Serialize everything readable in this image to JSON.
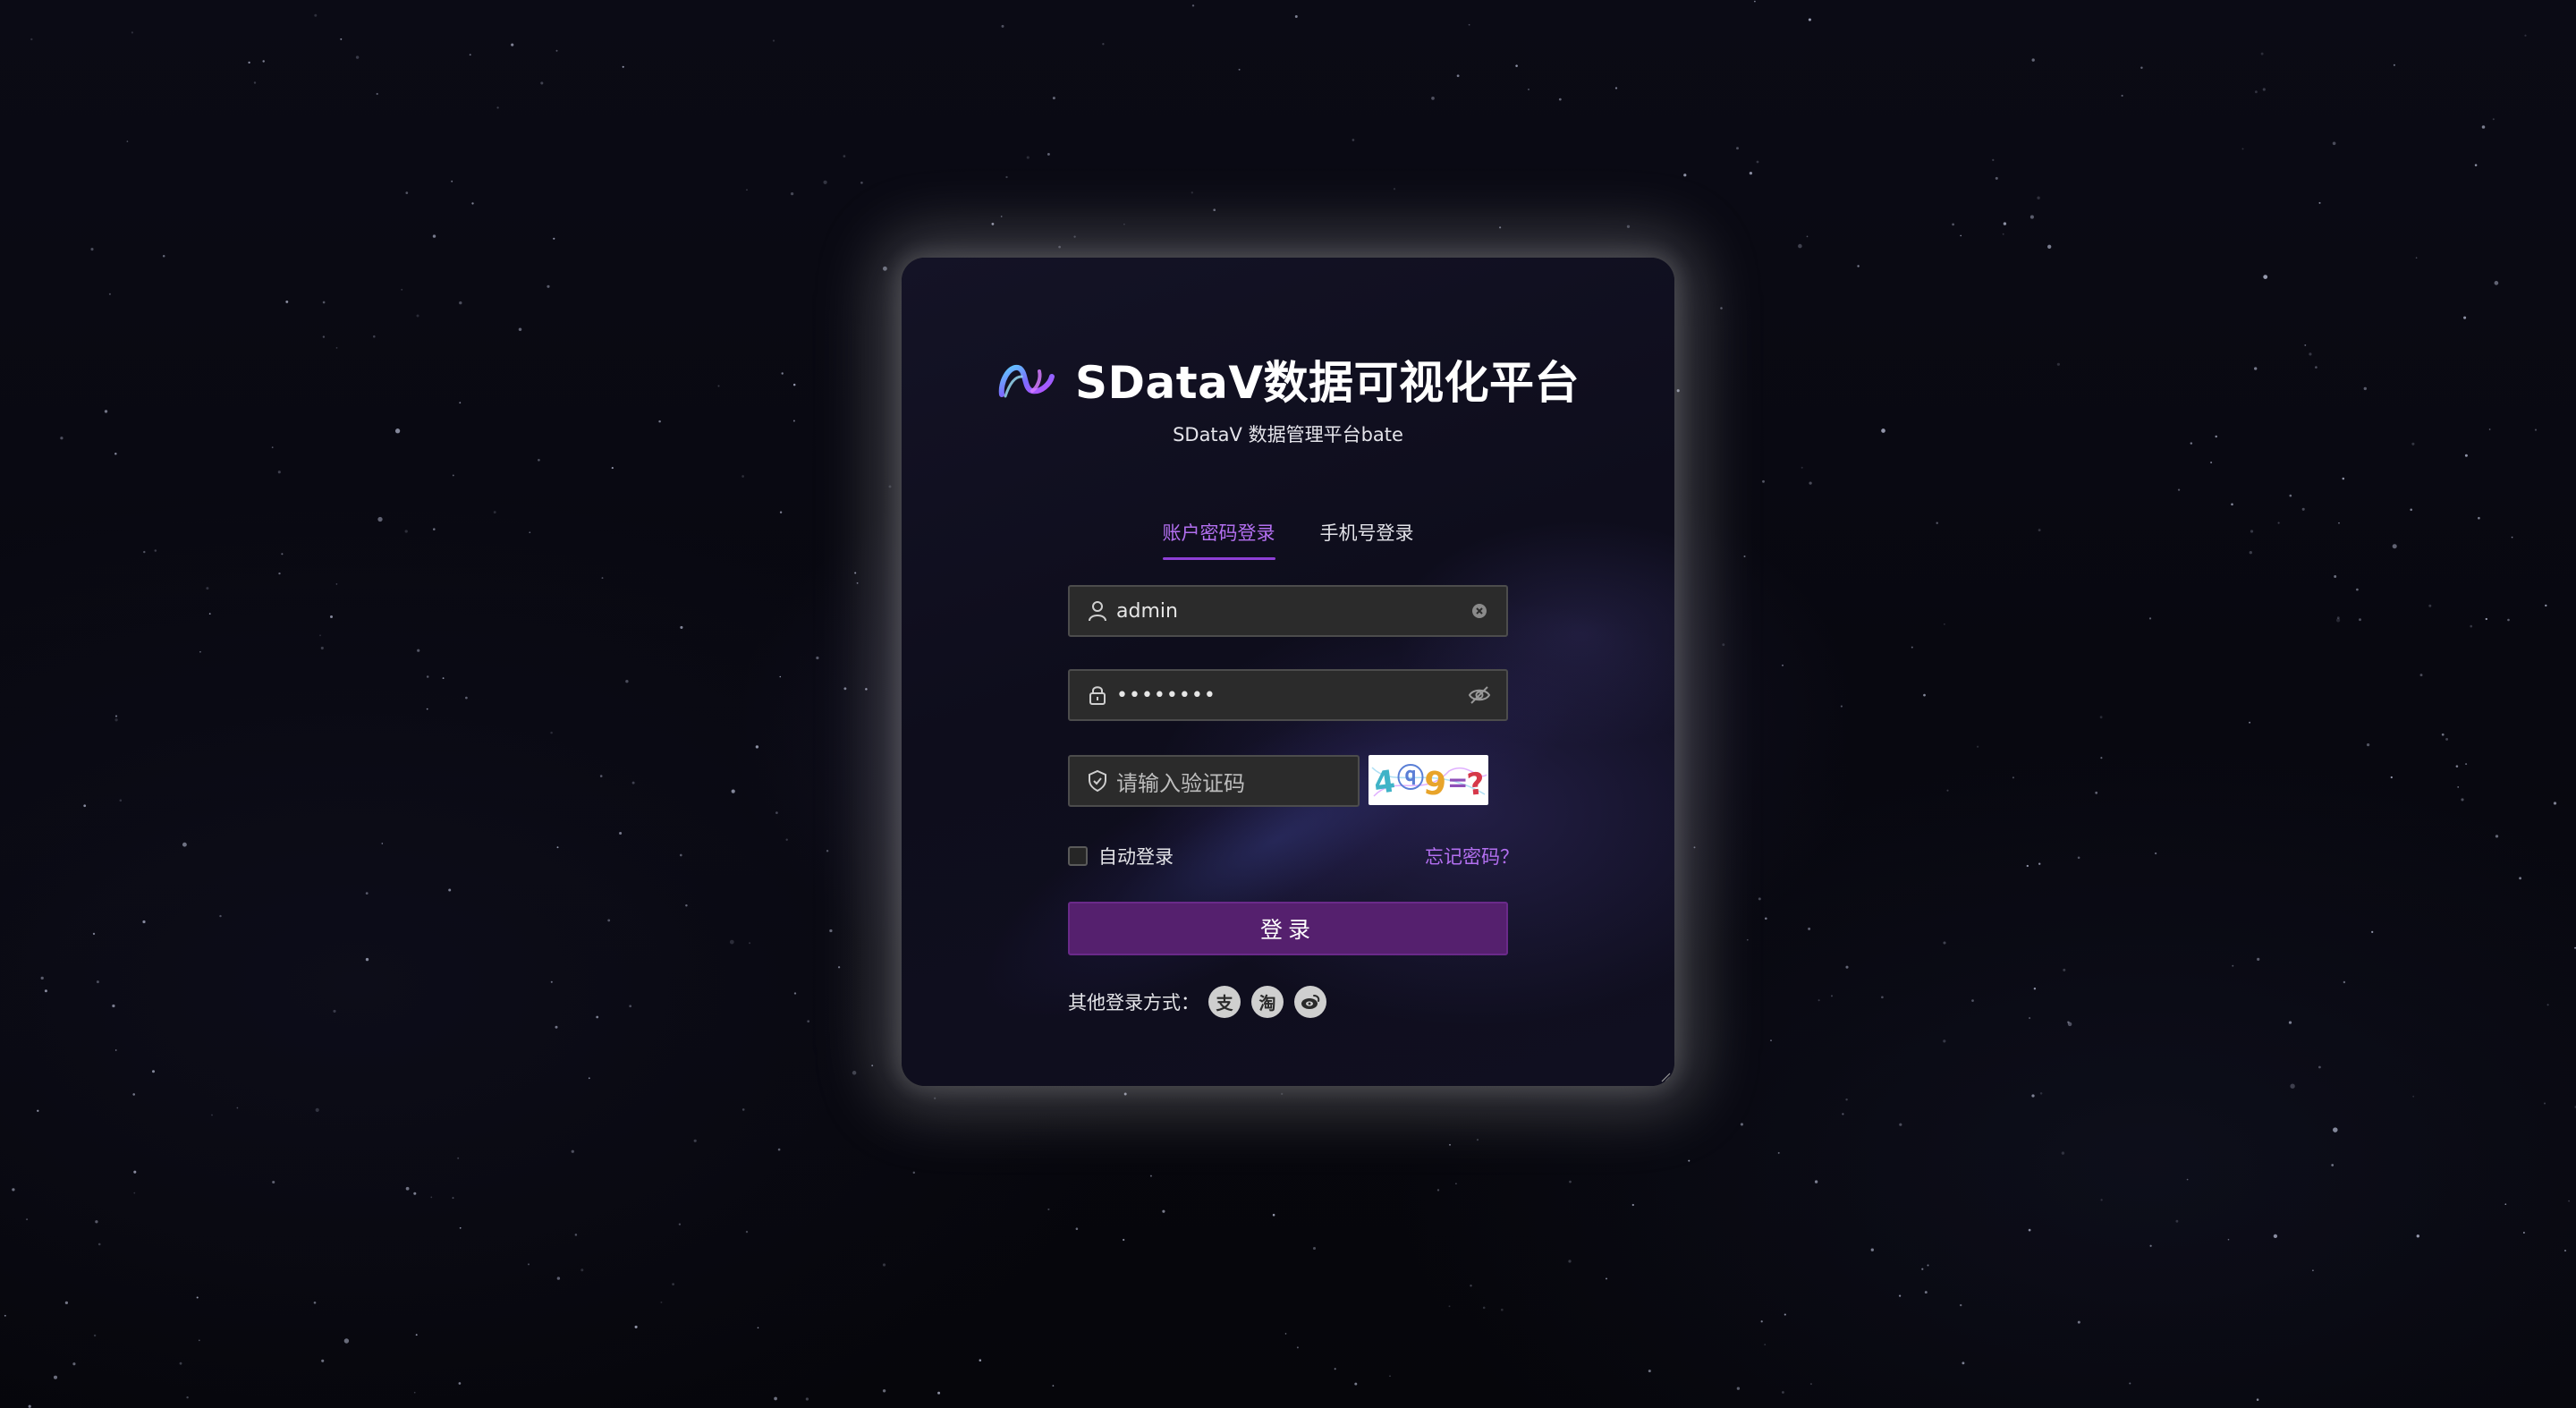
{
  "brand": {
    "title": "SDataV数据可视化平台",
    "subtitle": "SDataV 数据管理平台bate",
    "logo_icon": "infinity-ribbon-logo"
  },
  "tabs": [
    {
      "label": "账户密码登录",
      "active": true
    },
    {
      "label": "手机号登录",
      "active": false
    }
  ],
  "form": {
    "username": {
      "value": "admin",
      "prefix_icon": "user-icon",
      "suffix_icon": "clear-icon"
    },
    "password": {
      "value": "••••••••",
      "prefix_icon": "lock-icon",
      "suffix_icon": "eye-off-icon"
    },
    "captcha": {
      "placeholder": "请输入验证码",
      "prefix_icon": "shield-check-icon",
      "image_text": "4ⓠ9=?"
    },
    "remember_label": "自动登录",
    "remember_checked": false,
    "forgot_label": "忘记密码？",
    "submit_label": "登录"
  },
  "other_login": {
    "label": "其他登录方式：",
    "providers": [
      {
        "name": "alipay",
        "glyph": "支",
        "icon": "alipay-icon"
      },
      {
        "name": "taobao",
        "glyph": "淘",
        "icon": "taobao-icon"
      },
      {
        "name": "weibo",
        "glyph": "微",
        "icon": "weibo-icon"
      }
    ]
  },
  "colors": {
    "accent": "#b36ff0",
    "button": "#55206e",
    "input_bg": "#2b2b2b",
    "background": "#07070e"
  }
}
